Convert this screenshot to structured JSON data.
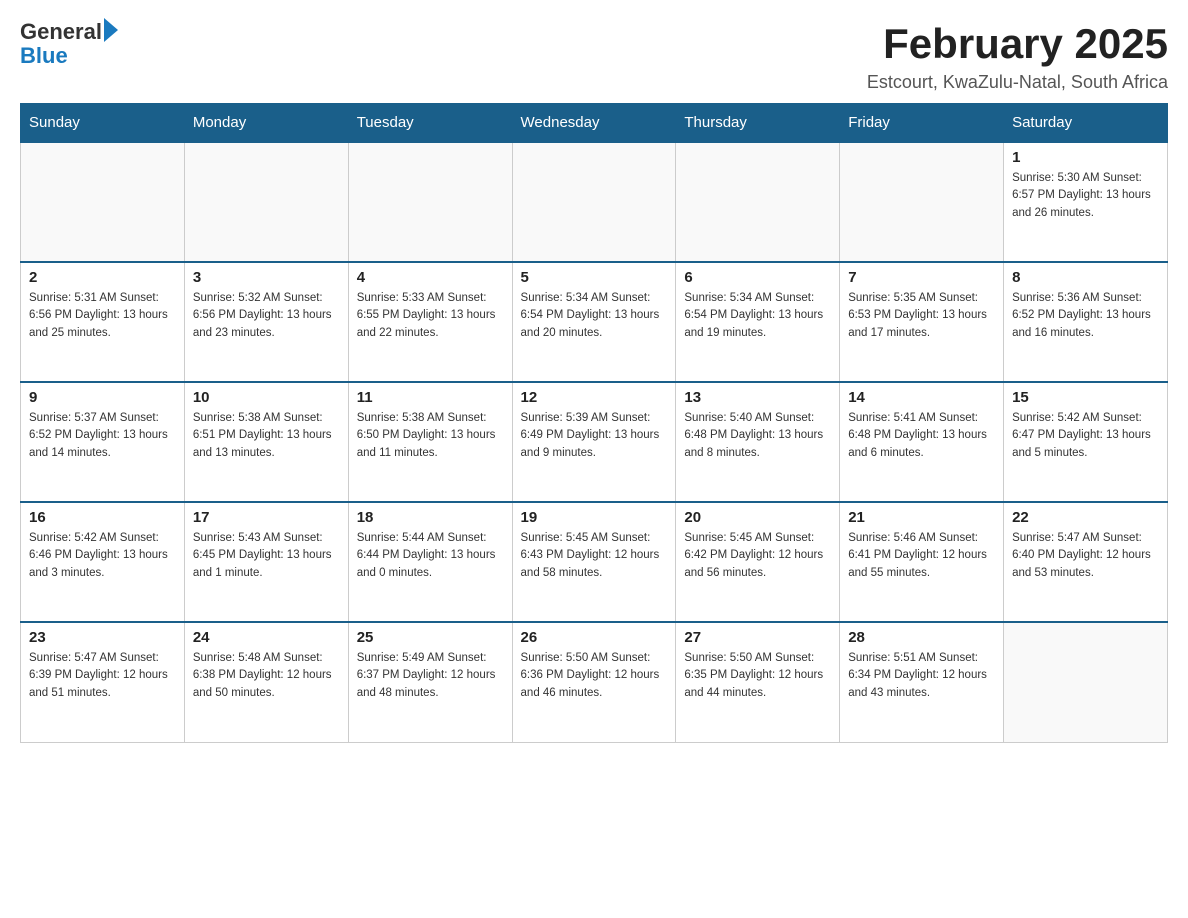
{
  "header": {
    "logo_general": "General",
    "logo_blue": "Blue",
    "month_title": "February 2025",
    "location": "Estcourt, KwaZulu-Natal, South Africa"
  },
  "days_of_week": [
    "Sunday",
    "Monday",
    "Tuesday",
    "Wednesday",
    "Thursday",
    "Friday",
    "Saturday"
  ],
  "weeks": [
    [
      {
        "day": "",
        "info": ""
      },
      {
        "day": "",
        "info": ""
      },
      {
        "day": "",
        "info": ""
      },
      {
        "day": "",
        "info": ""
      },
      {
        "day": "",
        "info": ""
      },
      {
        "day": "",
        "info": ""
      },
      {
        "day": "1",
        "info": "Sunrise: 5:30 AM\nSunset: 6:57 PM\nDaylight: 13 hours and 26 minutes."
      }
    ],
    [
      {
        "day": "2",
        "info": "Sunrise: 5:31 AM\nSunset: 6:56 PM\nDaylight: 13 hours and 25 minutes."
      },
      {
        "day": "3",
        "info": "Sunrise: 5:32 AM\nSunset: 6:56 PM\nDaylight: 13 hours and 23 minutes."
      },
      {
        "day": "4",
        "info": "Sunrise: 5:33 AM\nSunset: 6:55 PM\nDaylight: 13 hours and 22 minutes."
      },
      {
        "day": "5",
        "info": "Sunrise: 5:34 AM\nSunset: 6:54 PM\nDaylight: 13 hours and 20 minutes."
      },
      {
        "day": "6",
        "info": "Sunrise: 5:34 AM\nSunset: 6:54 PM\nDaylight: 13 hours and 19 minutes."
      },
      {
        "day": "7",
        "info": "Sunrise: 5:35 AM\nSunset: 6:53 PM\nDaylight: 13 hours and 17 minutes."
      },
      {
        "day": "8",
        "info": "Sunrise: 5:36 AM\nSunset: 6:52 PM\nDaylight: 13 hours and 16 minutes."
      }
    ],
    [
      {
        "day": "9",
        "info": "Sunrise: 5:37 AM\nSunset: 6:52 PM\nDaylight: 13 hours and 14 minutes."
      },
      {
        "day": "10",
        "info": "Sunrise: 5:38 AM\nSunset: 6:51 PM\nDaylight: 13 hours and 13 minutes."
      },
      {
        "day": "11",
        "info": "Sunrise: 5:38 AM\nSunset: 6:50 PM\nDaylight: 13 hours and 11 minutes."
      },
      {
        "day": "12",
        "info": "Sunrise: 5:39 AM\nSunset: 6:49 PM\nDaylight: 13 hours and 9 minutes."
      },
      {
        "day": "13",
        "info": "Sunrise: 5:40 AM\nSunset: 6:48 PM\nDaylight: 13 hours and 8 minutes."
      },
      {
        "day": "14",
        "info": "Sunrise: 5:41 AM\nSunset: 6:48 PM\nDaylight: 13 hours and 6 minutes."
      },
      {
        "day": "15",
        "info": "Sunrise: 5:42 AM\nSunset: 6:47 PM\nDaylight: 13 hours and 5 minutes."
      }
    ],
    [
      {
        "day": "16",
        "info": "Sunrise: 5:42 AM\nSunset: 6:46 PM\nDaylight: 13 hours and 3 minutes."
      },
      {
        "day": "17",
        "info": "Sunrise: 5:43 AM\nSunset: 6:45 PM\nDaylight: 13 hours and 1 minute."
      },
      {
        "day": "18",
        "info": "Sunrise: 5:44 AM\nSunset: 6:44 PM\nDaylight: 13 hours and 0 minutes."
      },
      {
        "day": "19",
        "info": "Sunrise: 5:45 AM\nSunset: 6:43 PM\nDaylight: 12 hours and 58 minutes."
      },
      {
        "day": "20",
        "info": "Sunrise: 5:45 AM\nSunset: 6:42 PM\nDaylight: 12 hours and 56 minutes."
      },
      {
        "day": "21",
        "info": "Sunrise: 5:46 AM\nSunset: 6:41 PM\nDaylight: 12 hours and 55 minutes."
      },
      {
        "day": "22",
        "info": "Sunrise: 5:47 AM\nSunset: 6:40 PM\nDaylight: 12 hours and 53 minutes."
      }
    ],
    [
      {
        "day": "23",
        "info": "Sunrise: 5:47 AM\nSunset: 6:39 PM\nDaylight: 12 hours and 51 minutes."
      },
      {
        "day": "24",
        "info": "Sunrise: 5:48 AM\nSunset: 6:38 PM\nDaylight: 12 hours and 50 minutes."
      },
      {
        "day": "25",
        "info": "Sunrise: 5:49 AM\nSunset: 6:37 PM\nDaylight: 12 hours and 48 minutes."
      },
      {
        "day": "26",
        "info": "Sunrise: 5:50 AM\nSunset: 6:36 PM\nDaylight: 12 hours and 46 minutes."
      },
      {
        "day": "27",
        "info": "Sunrise: 5:50 AM\nSunset: 6:35 PM\nDaylight: 12 hours and 44 minutes."
      },
      {
        "day": "28",
        "info": "Sunrise: 5:51 AM\nSunset: 6:34 PM\nDaylight: 12 hours and 43 minutes."
      },
      {
        "day": "",
        "info": ""
      }
    ]
  ]
}
